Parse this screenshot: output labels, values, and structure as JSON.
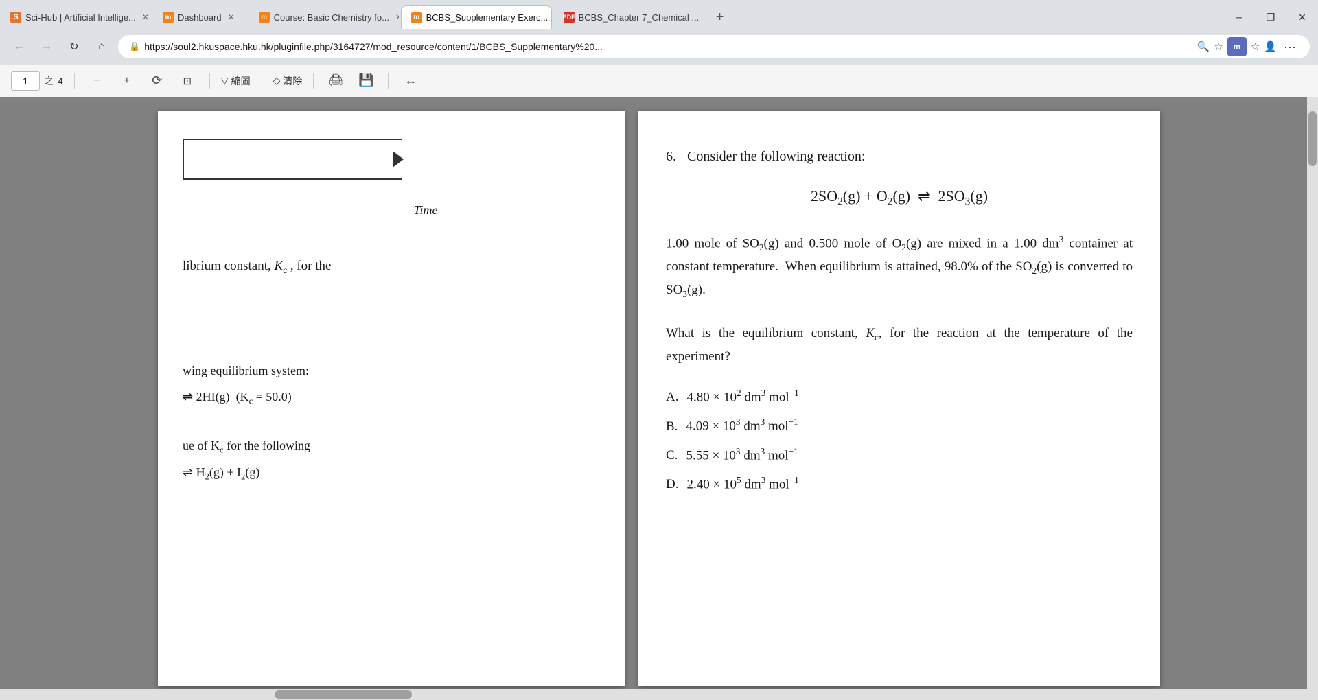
{
  "browser": {
    "tabs": [
      {
        "id": "tab1",
        "label": "Sci-Hub | Artificial Intellige...",
        "favicon_type": "sci-hub",
        "favicon_label": "S",
        "active": false
      },
      {
        "id": "tab2",
        "label": "Dashboard",
        "favicon_type": "moodle",
        "favicon_label": "m",
        "active": false
      },
      {
        "id": "tab3",
        "label": "Course: Basic Chemistry fo...",
        "favicon_type": "moodle",
        "favicon_label": "m",
        "active": false
      },
      {
        "id": "tab4",
        "label": "BCBS_Supplementary Exerc...",
        "favicon_type": "moodle",
        "favicon_label": "m",
        "active": true
      },
      {
        "id": "tab5",
        "label": "BCBS_Chapter 7_Chemical ...",
        "favicon_type": "pdf",
        "favicon_label": "PDF",
        "active": false
      }
    ],
    "address": "https://soul2.hkuspace.hku.hk/pluginfile.php/3164727/mod_resource/content/1/BCBS_Supplementary%20...",
    "new_tab_label": "+",
    "window_controls": {
      "minimize": "─",
      "maximize": "❐",
      "close": "✕"
    }
  },
  "pdf_toolbar": {
    "page_current": "1",
    "page_separator": "之",
    "page_total": "4",
    "zoom_out": "−",
    "zoom_in": "+",
    "rotate": "↺",
    "fit_page": "⊡",
    "annotate_label": "▽ 縮圖",
    "clear_label": "◇ 清除",
    "print_label": "🖨",
    "save_label": "💾",
    "expand_label": "↔"
  },
  "left_page": {
    "diagram_label": "Time",
    "text1": "librium constant,",
    "kc_symbol": "K",
    "kc_sub": "c",
    "text2": ", for the",
    "equilibrium_system_title": "wing equilibrium system:",
    "eq1_left": "⇌ 2HI(g)",
    "eq1_kc": "(K",
    "eq1_kc_sub": "c",
    "eq1_kc_val": " = 50.0)",
    "eq2_title": "ue of K",
    "eq2_kc_sub": "c",
    "eq2_title2": " for the following",
    "eq2_reaction_left": "⇌ H",
    "eq2_h2_sub": "2",
    "eq2_reaction_mid": "(g) + I",
    "eq2_i2_sub": "2",
    "eq2_reaction_right": "(g)"
  },
  "right_page": {
    "question_number": "6.",
    "question_title": "Consider the following reaction:",
    "reaction": "2SO₂(g) + O₂(g) ⇌ 2SO₃(g)",
    "body": "1.00 mole of SO₂(g) and 0.500 mole of O₂(g) are mixed in a 1.00 dm³ container at constant temperature. When equilibrium is attained, 98.0% of the SO₂(g) is converted to SO₃(g).",
    "question_part": "What is the equilibrium constant, Kc, for the reaction at the temperature of the experiment?",
    "choices": [
      {
        "label": "A.",
        "value": "4.80 × 10² dm³ mol⁻¹"
      },
      {
        "label": "B.",
        "value": "4.09 × 10³ dm³ mol⁻¹"
      },
      {
        "label": "C.",
        "value": "5.55 × 10³ dm³ mol⁻¹"
      },
      {
        "label": "D.",
        "value": "2.40 × 10⁵ dm³ mol⁻¹"
      }
    ]
  },
  "page_indicator": {
    "of_text": "of"
  }
}
